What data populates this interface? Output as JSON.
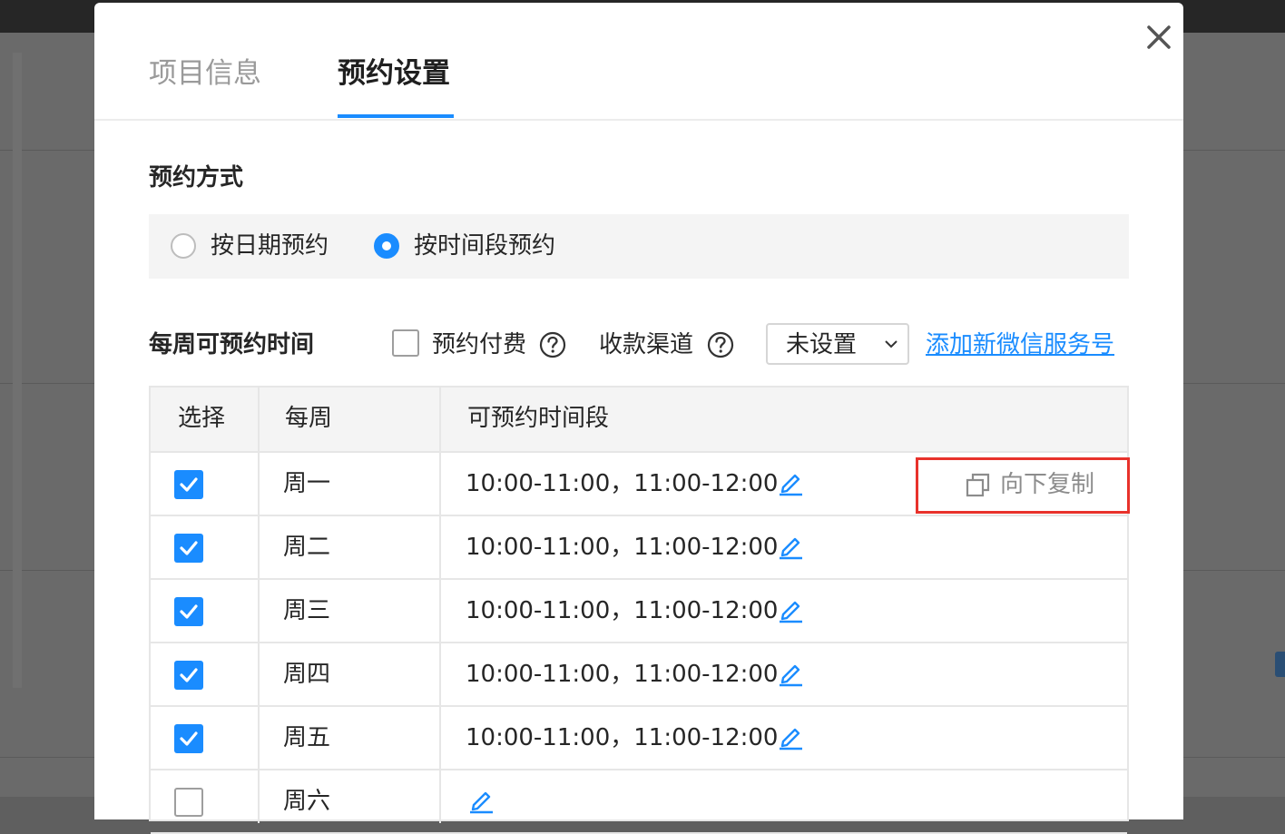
{
  "colors": {
    "accent": "#1a8cff",
    "highlight_border": "#e8322b"
  },
  "tabs": [
    {
      "label": "项目信息",
      "active": false
    },
    {
      "label": "预约设置",
      "active": true
    }
  ],
  "booking_method": {
    "title": "预约方式",
    "options": [
      {
        "label": "按日期预约",
        "selected": false
      },
      {
        "label": "按时间段预约",
        "selected": true
      }
    ]
  },
  "weekly": {
    "title": "每周可预约时间",
    "paid_label": "预约付费",
    "paid_checked": false,
    "channel_label": "收款渠道",
    "channel_value": "未设置",
    "add_link": "添加新微信服务号"
  },
  "table": {
    "headers": [
      "选择",
      "每周",
      "可预约时间段"
    ],
    "copy_label": "向下复制",
    "rows": [
      {
        "day": "周一",
        "checked": true,
        "slots": "10:00-11:00，11:00-12:00"
      },
      {
        "day": "周二",
        "checked": true,
        "slots": "10:00-11:00，11:00-12:00"
      },
      {
        "day": "周三",
        "checked": true,
        "slots": "10:00-11:00，11:00-12:00"
      },
      {
        "day": "周四",
        "checked": true,
        "slots": "10:00-11:00，11:00-12:00"
      },
      {
        "day": "周五",
        "checked": true,
        "slots": "10:00-11:00，11:00-12:00"
      },
      {
        "day": "周六",
        "checked": false,
        "slots": ""
      }
    ]
  }
}
